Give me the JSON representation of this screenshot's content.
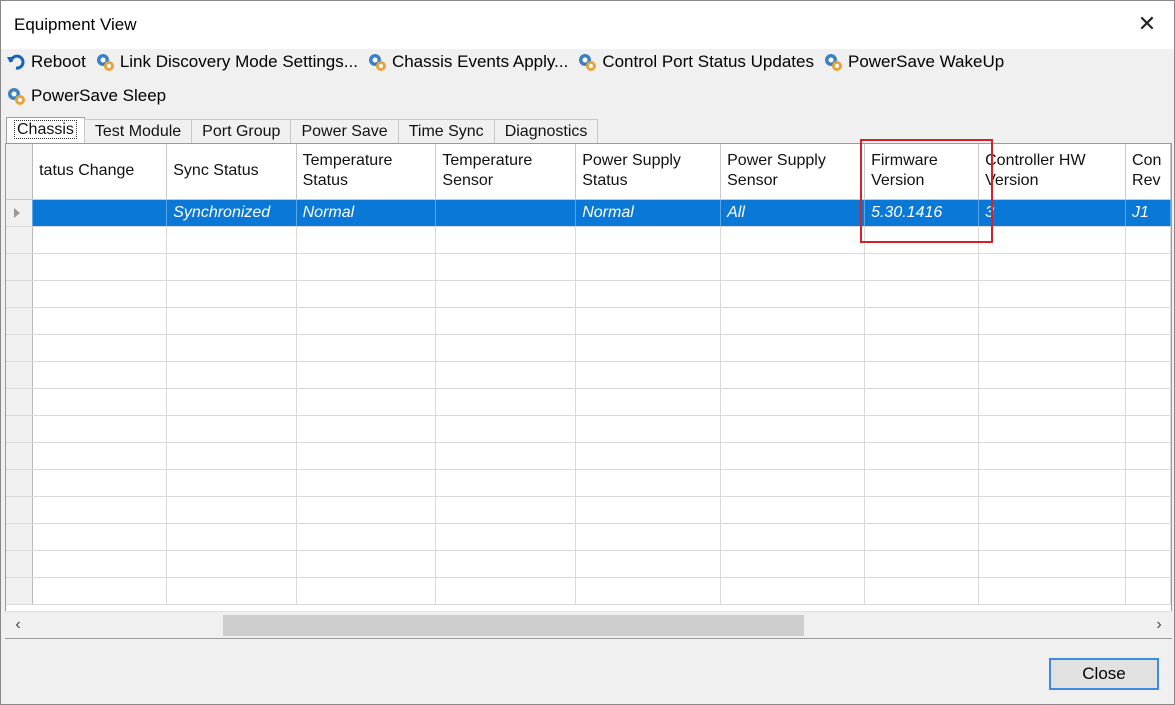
{
  "window": {
    "title": "Equipment View"
  },
  "toolbar": {
    "row1": [
      {
        "label": "Reboot",
        "icon": "reboot-icon"
      },
      {
        "label": "Link Discovery Mode Settings...",
        "icon": "gear-icon"
      },
      {
        "label": "Chassis Events Apply...",
        "icon": "gear-icon"
      },
      {
        "label": "Control Port Status Updates",
        "icon": "gear-icon"
      },
      {
        "label": "PowerSave WakeUp",
        "icon": "gear-icon"
      }
    ],
    "row2": [
      {
        "label": "PowerSave Sleep",
        "icon": "gear-icon"
      }
    ]
  },
  "tabs": [
    "Chassis",
    "Test Module",
    "Port Group",
    "Power Save",
    "Time Sync",
    "Diagnostics"
  ],
  "active_tab": "Chassis",
  "grid": {
    "columns": [
      {
        "line1": "tatus Change",
        "line2": ""
      },
      {
        "line1": "Sync Status",
        "line2": ""
      },
      {
        "line1": "Temperature",
        "line2": "Status"
      },
      {
        "line1": "Temperature",
        "line2": "Sensor"
      },
      {
        "line1": "Power Supply",
        "line2": "Status"
      },
      {
        "line1": "Power Supply",
        "line2": "Sensor"
      },
      {
        "line1": "Firmware",
        "line2": "Version"
      },
      {
        "line1": "Controller HW",
        "line2": "Version"
      },
      {
        "line1": "Con",
        "line2": "Rev"
      }
    ],
    "selected_row": [
      "",
      "Synchronized",
      "Normal",
      "",
      "Normal",
      "All",
      "5.30.1416",
      "3",
      "J1"
    ],
    "empty_rows": 14
  },
  "colors": {
    "selection": "#0a78d7",
    "highlight_box": "#d2232a"
  },
  "footer": {
    "close_label": "Close"
  }
}
